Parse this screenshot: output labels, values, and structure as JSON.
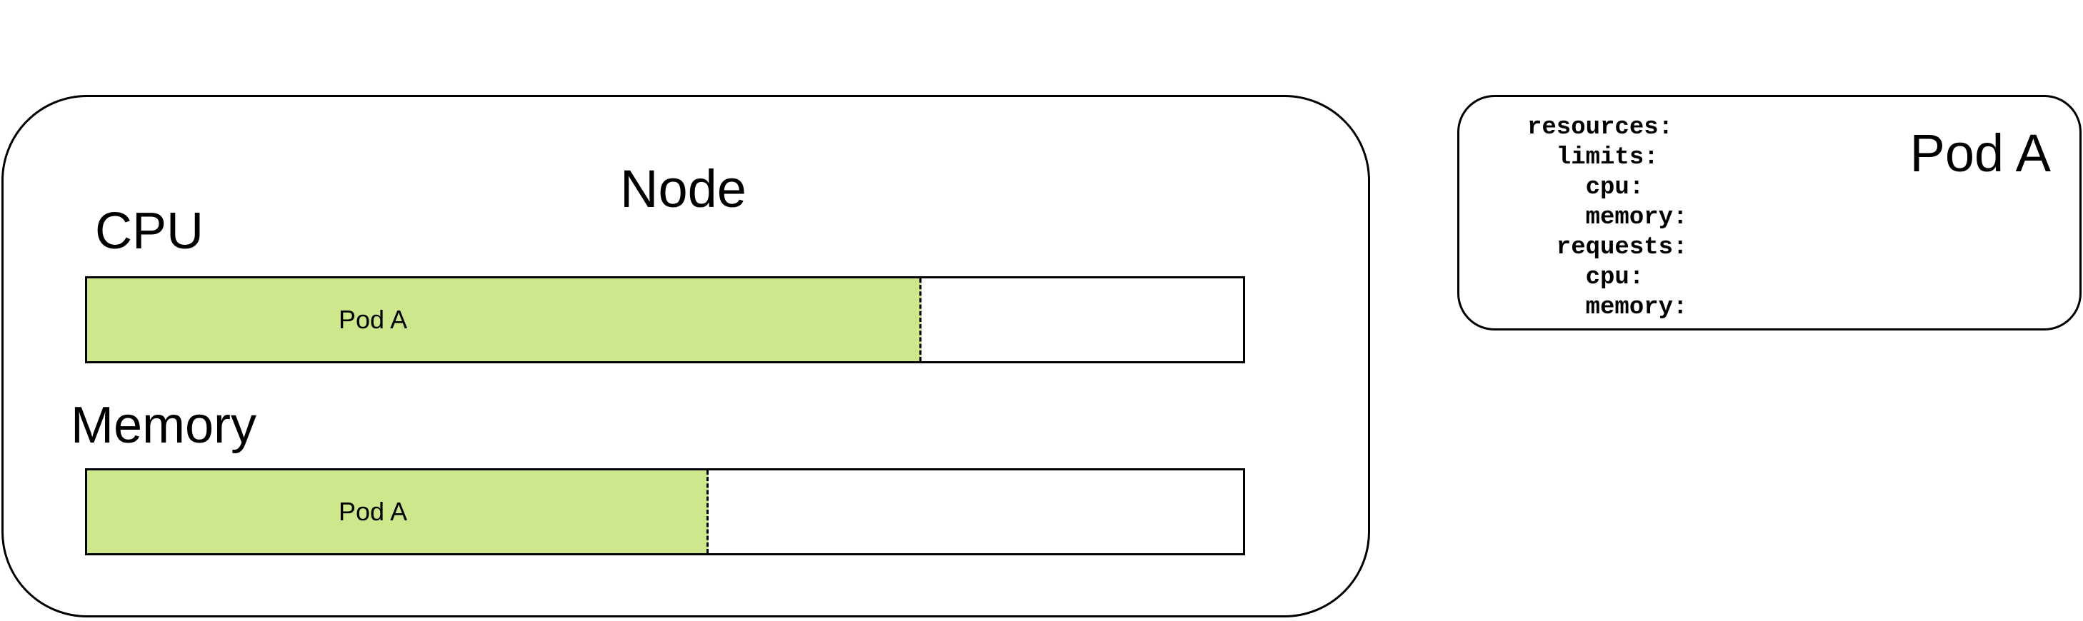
{
  "node": {
    "title": "Node",
    "cpu": {
      "label": "CPU",
      "pod_label": "Pod A",
      "fill_fraction": 0.722,
      "fill_color": "#cde88c"
    },
    "memory": {
      "label": "Memory",
      "pod_label": "Pod A",
      "fill_fraction": 0.538,
      "fill_color": "#cde88c"
    }
  },
  "pod_card": {
    "title": "Pod A",
    "spec_lines": [
      "resources:",
      "  limits:",
      "    cpu:",
      "    memory:",
      "  requests:",
      "    cpu:",
      "    memory:"
    ]
  }
}
